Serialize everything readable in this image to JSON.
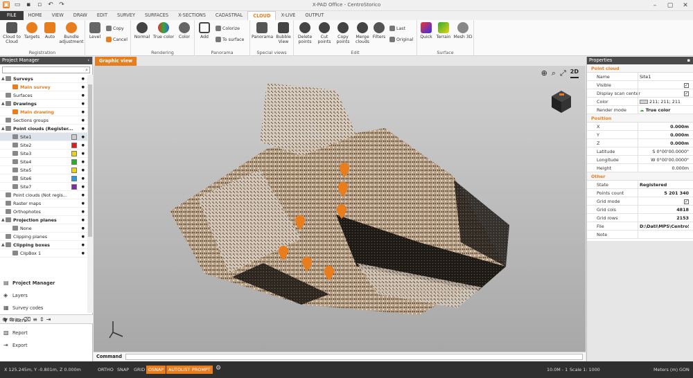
{
  "window": {
    "title": "X-PAD Office - CentroStorico"
  },
  "quick_access": [
    "app-icon",
    "open-icon",
    "save-icon",
    "save-as-icon",
    "undo-icon",
    "redo-icon"
  ],
  "menu_tabs": [
    "FILE",
    "HOME",
    "VIEW",
    "DRAW",
    "EDIT",
    "SURVEY",
    "SURFACES",
    "X-SECTIONS",
    "CADASTRAL",
    "CLOUD",
    "X-LIVE",
    "OUTPUT"
  ],
  "active_tab": "CLOUD",
  "ribbon": {
    "registration": {
      "label": "Registration",
      "cloud_to_cloud": "Cloud to Cloud",
      "targets": "Targets",
      "auto": "Auto",
      "bundle": "Bundle adjustment"
    },
    "level": "Level",
    "copy": "Copy",
    "cancel": "Cancel",
    "rendering": {
      "label": "Rendering",
      "normal": "Normal",
      "true_color": "True color",
      "color": "Color"
    },
    "panorama": {
      "label": "Panorama",
      "add": "Add",
      "colorize": "Colorize",
      "to_surface": "To surface"
    },
    "special": {
      "label": "Special views",
      "panorama": "Panorama",
      "bubble": "Bubble View"
    },
    "edit": {
      "label": "Edit",
      "delete": "Delete points",
      "cut": "Cut points",
      "copyp": "Copy points",
      "merge": "Merge clouds",
      "filters": "Filters",
      "last": "Last",
      "original": "Original"
    },
    "surface": {
      "label": "Surface",
      "quick": "Quick",
      "terrain": "Terrain",
      "mesh": "Mesh 3D"
    }
  },
  "project_manager": {
    "title": "Project Manager",
    "tree": [
      {
        "label": "Surveys",
        "level": 0,
        "kind": "hdr",
        "exp": "▲"
      },
      {
        "label": "Main survey",
        "level": 1,
        "kind": "orange"
      },
      {
        "label": "Surfaces",
        "level": 0,
        "kind": "normal"
      },
      {
        "label": "Drawings",
        "level": 0,
        "kind": "hdr",
        "exp": "▲"
      },
      {
        "label": "Main drawing",
        "level": 1,
        "kind": "orange"
      },
      {
        "label": "Sections groups",
        "level": 0,
        "kind": "normal"
      },
      {
        "label": "Point clouds (Register...",
        "level": 0,
        "kind": "hdr",
        "exp": "▲"
      },
      {
        "label": "Site1",
        "level": 1,
        "kind": "sel",
        "color": "#cccccc"
      },
      {
        "label": "Site2",
        "level": 1,
        "kind": "normal",
        "color": "#e21b1b"
      },
      {
        "label": "Site3",
        "level": 1,
        "kind": "normal",
        "color": "#e8d412"
      },
      {
        "label": "Site4",
        "level": 1,
        "kind": "normal",
        "color": "#22b322"
      },
      {
        "label": "Site5",
        "level": 1,
        "kind": "normal",
        "color": "#e8d412"
      },
      {
        "label": "Site6",
        "level": 1,
        "kind": "normal",
        "color": "#2a9be0"
      },
      {
        "label": "Site7",
        "level": 1,
        "kind": "normal",
        "color": "#7b2ab0"
      },
      {
        "label": "Point clouds (Not regis...",
        "level": 0,
        "kind": "normal"
      },
      {
        "label": "Raster maps",
        "level": 0,
        "kind": "normal"
      },
      {
        "label": "Orthophotos",
        "level": 0,
        "kind": "normal"
      },
      {
        "label": "Projection planes",
        "level": 0,
        "kind": "hdr",
        "exp": "▲"
      },
      {
        "label": "None",
        "level": 1,
        "kind": "normal"
      },
      {
        "label": "Clipping planes",
        "level": 0,
        "kind": "normal"
      },
      {
        "label": "Clipping boxes",
        "level": 0,
        "kind": "hdr",
        "exp": "▲"
      },
      {
        "label": "ClipBox 1",
        "level": 1,
        "kind": "normal"
      }
    ],
    "nav": [
      "Project Manager",
      "Layers",
      "Survey codes",
      "Filters",
      "Report",
      "Export"
    ]
  },
  "graphic_view": {
    "tab": "Graphic view"
  },
  "command": {
    "label": "Command",
    "value": ""
  },
  "properties": {
    "title": "Properties",
    "sections": [
      {
        "name": "Point cloud",
        "rows": [
          {
            "k": "Name",
            "v": "Site1",
            "align": "l"
          },
          {
            "k": "Visible",
            "check": true
          },
          {
            "k": "Display scan center",
            "check": true
          },
          {
            "k": "Color",
            "v": "211; 211; 211",
            "swatch": "#d3d3d3",
            "align": "l"
          },
          {
            "k": "Render mode",
            "v": "True color",
            "align": "l",
            "bold": true
          }
        ]
      },
      {
        "name": "Position",
        "rows": [
          {
            "k": "X",
            "v": "0.000m",
            "bold": true
          },
          {
            "k": "Y",
            "v": "0.000m",
            "bold": true
          },
          {
            "k": "Z",
            "v": "0.000m",
            "bold": true
          },
          {
            "k": "Latitude",
            "v": "S 0°00'00.0000\""
          },
          {
            "k": "Longitude",
            "v": "W 0°00'00.0000\""
          },
          {
            "k": "Height",
            "v": "0.000m"
          }
        ]
      },
      {
        "name": "Other",
        "rows": [
          {
            "k": "State",
            "v": "Registered",
            "align": "l",
            "bold": true
          },
          {
            "k": "Points count",
            "v": "5 201 340",
            "bold": true
          },
          {
            "k": "Grid mode",
            "check": true
          },
          {
            "k": "Grid cols",
            "v": "4818",
            "bold": true
          },
          {
            "k": "Grid rows",
            "v": "2153",
            "bold": true
          },
          {
            "k": "File",
            "v": "D:\\Dati\\MPS\\CentroSt...",
            "align": "l",
            "bold": true
          },
          {
            "k": "Note",
            "v": ""
          }
        ]
      }
    ]
  },
  "status": {
    "coords": "X 125.245m, Y -0.801m, Z 0.000m",
    "buttons": [
      {
        "label": "ORTHO",
        "on": false
      },
      {
        "label": "SNAP",
        "on": false
      },
      {
        "label": "GRID",
        "on": false
      },
      {
        "label": "OSNAP",
        "on": true
      },
      {
        "label": "AUTOLIST",
        "on": true
      },
      {
        "label": "PROMPT",
        "on": true
      }
    ],
    "tolerance": "10.0M - 1",
    "scale": "Scale 1: 1000",
    "units": "Meters (m)",
    "angle": "GON"
  },
  "colors": {
    "accent": "#e87d1e",
    "dark": "#2f2f2f"
  }
}
